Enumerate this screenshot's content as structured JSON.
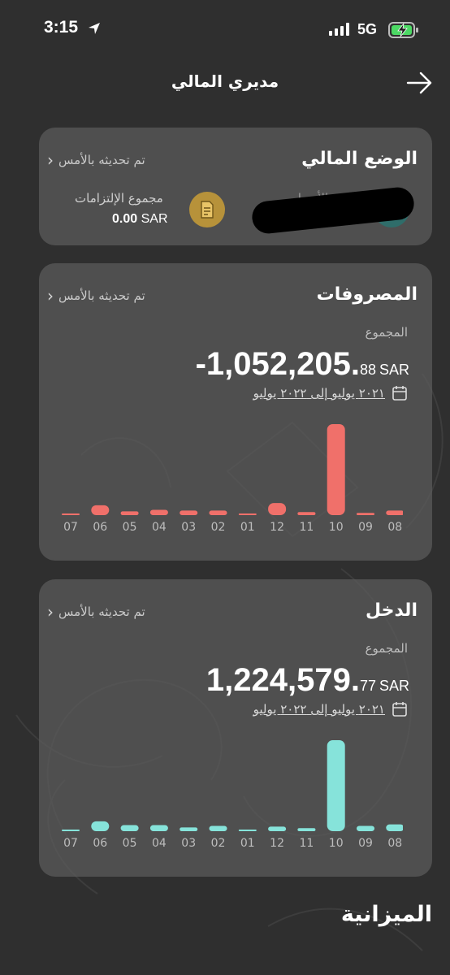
{
  "status_bar": {
    "time": "3:15",
    "network": "5G"
  },
  "nav": {
    "title": "مديري المالي"
  },
  "financial_status": {
    "title": "الوضع المالي",
    "updated": "تم تحديثه بالأمس",
    "liabilities_label": "مجموع الإلتزامات",
    "liabilities_value": "0.00",
    "liabilities_currency": "SAR",
    "assets_label": "مجموع الأصول"
  },
  "expenses": {
    "title": "المصروفات",
    "updated": "تم تحديثه بالأمس",
    "total_label": "المجموع",
    "amount_int": "-1,052,205.",
    "amount_dec": "88",
    "currency": "SAR",
    "date_range": "٢٠٢١ يوليو إلى ٢٠٢٢ يوليو",
    "color": "#f0706a"
  },
  "income": {
    "title": "الدخل",
    "updated": "تم تحديثه بالأمس",
    "total_label": "المجموع",
    "amount_int": "1,224,579.",
    "amount_dec": "77",
    "currency": "SAR",
    "date_range": "٢٠٢١ يوليو إلى ٢٠٢٢ يوليو",
    "color": "#86e3da"
  },
  "budget": {
    "title": "الميزانية"
  },
  "chart_data": [
    {
      "type": "bar",
      "categories": [
        "07",
        "06",
        "05",
        "04",
        "03",
        "02",
        "01",
        "12",
        "11",
        "10",
        "09",
        "08"
      ],
      "values": [
        0.1,
        1.3,
        0.5,
        0.7,
        0.6,
        0.6,
        0.2,
        1.6,
        0.4,
        12.0,
        0.3,
        0.6
      ]
    },
    {
      "type": "bar",
      "categories": [
        "07",
        "06",
        "05",
        "04",
        "03",
        "02",
        "01",
        "12",
        "11",
        "10",
        "09",
        "08"
      ],
      "values": [
        0.1,
        1.3,
        0.8,
        0.8,
        0.5,
        0.7,
        0.2,
        0.6,
        0.4,
        12.0,
        0.7,
        0.9
      ]
    }
  ]
}
